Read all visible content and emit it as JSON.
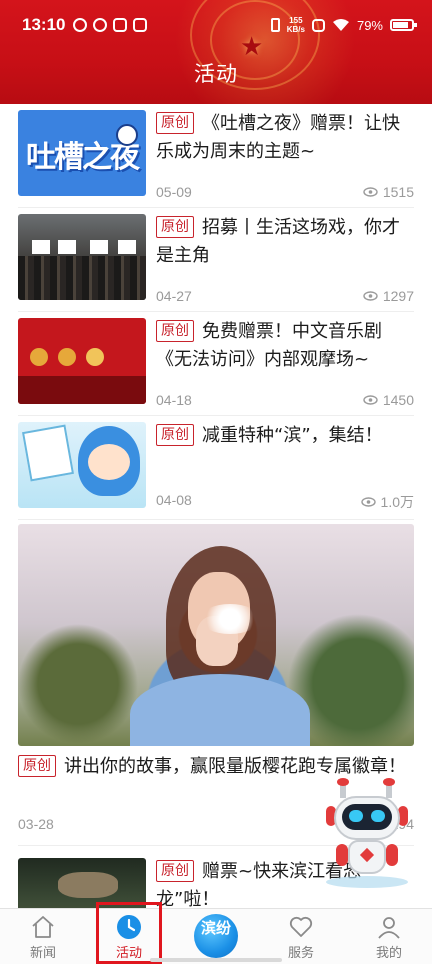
{
  "status_bar": {
    "time": "13:10",
    "network_speed_value": "155",
    "network_speed_unit": "KB/s",
    "battery_percent": "79%"
  },
  "header": {
    "title": "活动"
  },
  "badge_label": "原创",
  "articles": [
    {
      "title": "《吐槽之夜》赠票！让快乐成为周末的主题~",
      "date": "05-09",
      "views": "1515",
      "thumb_text": "吐槽之夜"
    },
    {
      "title": "招募丨生活这场戏，你才是主角",
      "date": "04-27",
      "views": "1297"
    },
    {
      "title": "免费赠票！中文音乐剧《无法访问》内部观摩场~",
      "date": "04-18",
      "views": "1450"
    },
    {
      "title": "减重特种“滨”，集结！",
      "date": "04-08",
      "views": "1.0万"
    }
  ],
  "featured": {
    "title": "讲出你的故事，赢限量版樱花跑专属徽章！",
    "date": "03-28",
    "views": "194"
  },
  "last_article": {
    "title": "赠票~快来滨江看恐龙”啦！"
  },
  "tabs": [
    {
      "label": "新闻",
      "icon": "home-icon",
      "active": false
    },
    {
      "label": "活动",
      "icon": "clock-icon",
      "active": true
    },
    {
      "label": "滨纷",
      "icon": "center-logo",
      "active": false
    },
    {
      "label": "服务",
      "icon": "heart-icon",
      "active": false
    },
    {
      "label": "我的",
      "icon": "user-icon",
      "active": false
    }
  ],
  "center_logo_text": "滨纷",
  "colors": {
    "brand_red": "#c70f16",
    "badge_red": "#c8232c",
    "active_tab": "#d21a22",
    "meta_gray": "#9a9a9a"
  }
}
